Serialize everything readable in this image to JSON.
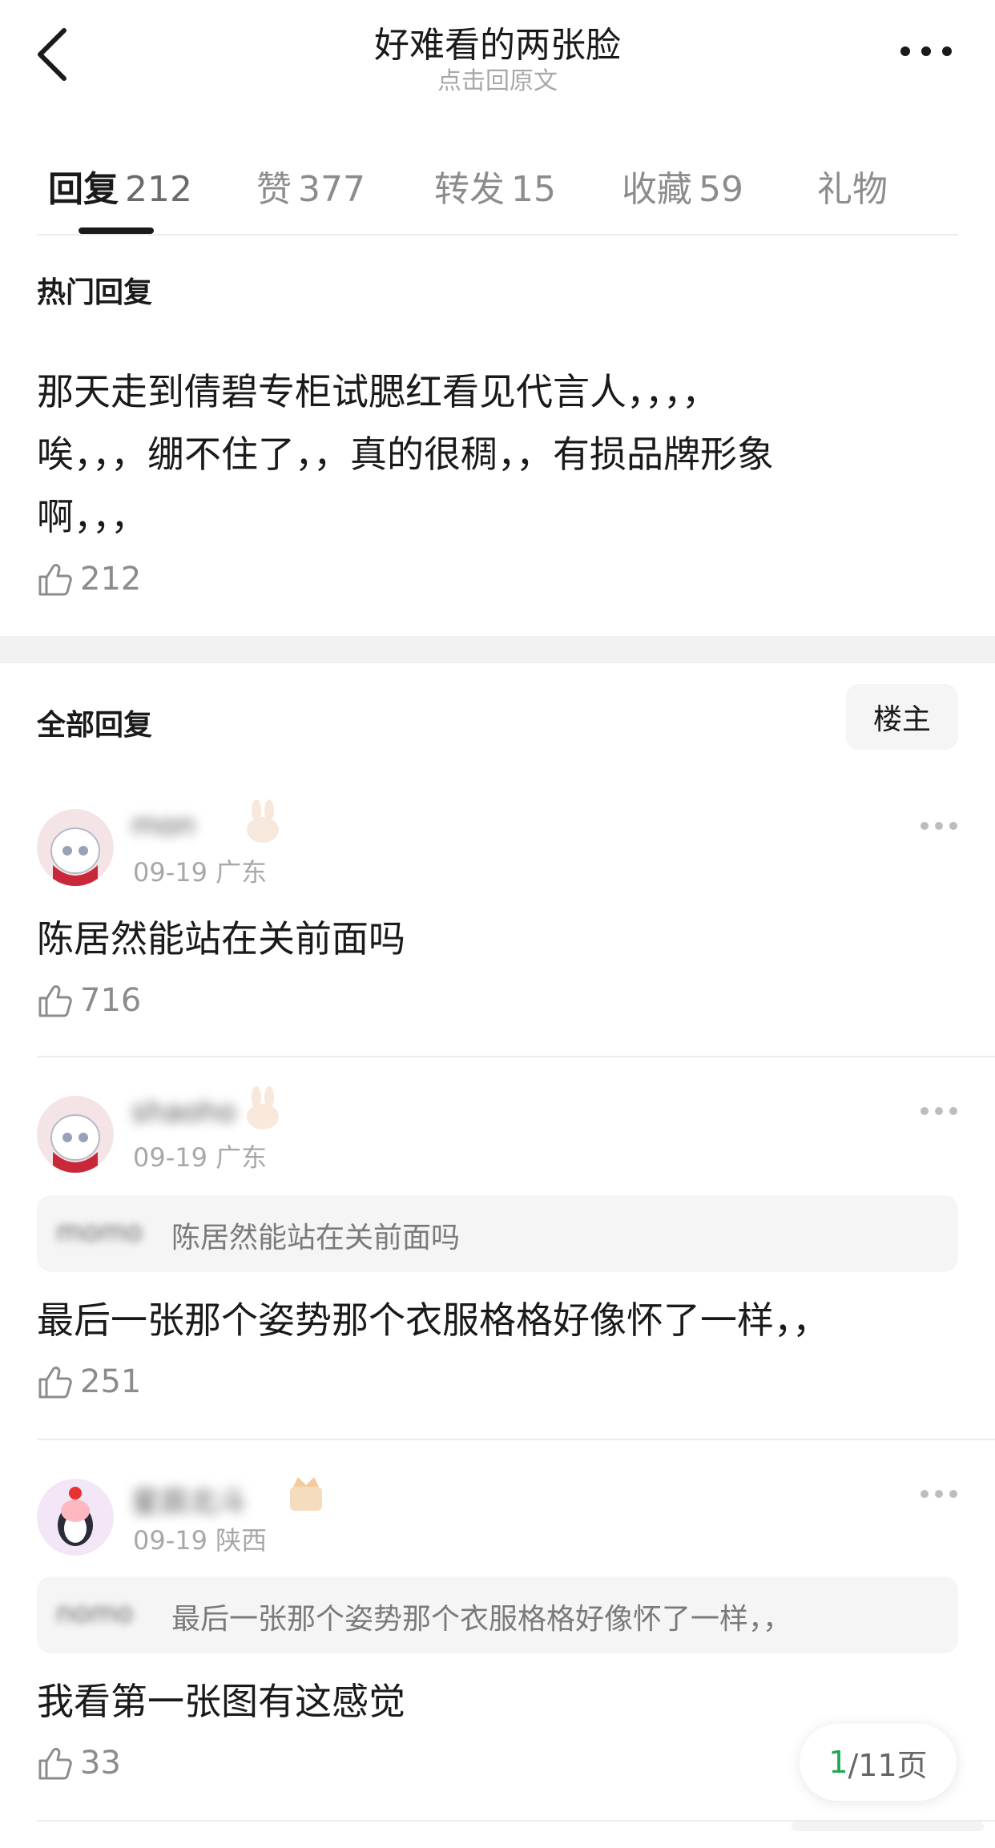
{
  "header": {
    "title": "好难看的两张脸",
    "subtitle": "点击回原文"
  },
  "tabs": [
    {
      "label": "回复",
      "count": "212",
      "active": true
    },
    {
      "label": "赞",
      "count": "377",
      "active": false
    },
    {
      "label": "转发",
      "count": "15",
      "active": false
    },
    {
      "label": "收藏",
      "count": "59",
      "active": false
    },
    {
      "label": "礼物",
      "count": "",
      "active": false
    }
  ],
  "hot": {
    "heading": "热门回复",
    "lines": [
      "那天走到倩碧专柜试腮红看见代言人，，，，",
      "唉，，，绷不住了，，真的很稠，，有损品牌形象",
      "啊，，，"
    ],
    "likes": "212"
  },
  "all": {
    "heading": "全部回复",
    "owner_button": "楼主"
  },
  "comments": [
    {
      "username": "mon",
      "date": "09-19",
      "location": "广东",
      "quote_user": "",
      "quote_text": "",
      "text": "陈居然能站在关前面吗",
      "likes": "716"
    },
    {
      "username": "shaoho",
      "date": "09-19",
      "location": "广东",
      "quote_user": "momo",
      "quote_text": "陈居然能站在关前面吗",
      "text": "最后一张那个姿势那个衣服格格好像怀了一样，，",
      "likes": "251"
    },
    {
      "username": "星辰北斗",
      "date": "09-19",
      "location": "陕西",
      "quote_user": "nomo",
      "quote_text": "最后一张那个姿势那个衣服格格好像怀了一样，，",
      "text": "我看第一张图有这感觉",
      "likes": "33"
    }
  ],
  "pager": {
    "current": "1",
    "total_text": "/11页"
  },
  "colors": {
    "accent_green": "#1fa84f",
    "divider": "#ececec",
    "muted_text": "#a8a8a8"
  },
  "icons": [
    "back-arrow-icon",
    "more-icon",
    "thumb-up-icon",
    "rabbit-badge-icon",
    "crown-badge-icon"
  ]
}
